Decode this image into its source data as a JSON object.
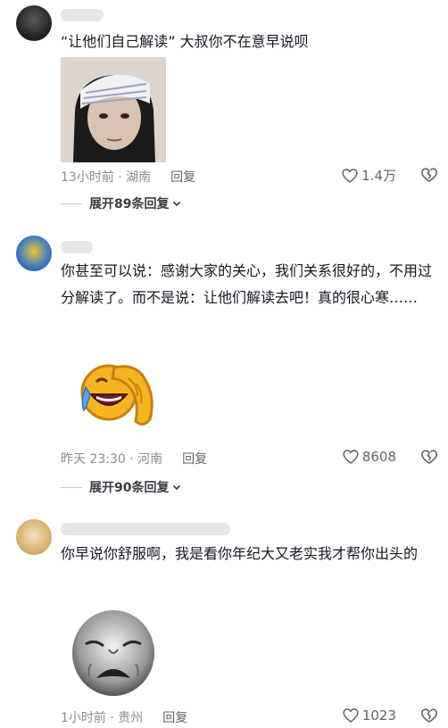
{
  "comments": [
    {
      "text": "“让他们自己解读” 大叔你不在意早说呗",
      "time_location": "13小时前 · 湖南",
      "reply_label": "回复",
      "likes": "1.4万",
      "expand_label": "展开89条回复"
    },
    {
      "text": "你甚至可以说：感谢大家的关心，我们关系很好的，不用过分解读了。而不是说：让他们解读去吧！真的很心寒……",
      "time_location": "昨天 23:30 · 河南",
      "reply_label": "回复",
      "likes": "8608",
      "expand_label": "展开90条回复"
    },
    {
      "text": "你早说你舒服啊，我是看你年纪大又老实我才帮你出头的",
      "time_location": "1小时前 · 贵州",
      "reply_label": "回复",
      "likes": "1023"
    }
  ],
  "icons": {
    "like": "heart-outline-icon",
    "dislike": "dislike-icon",
    "expand": "chevron-down-icon"
  }
}
